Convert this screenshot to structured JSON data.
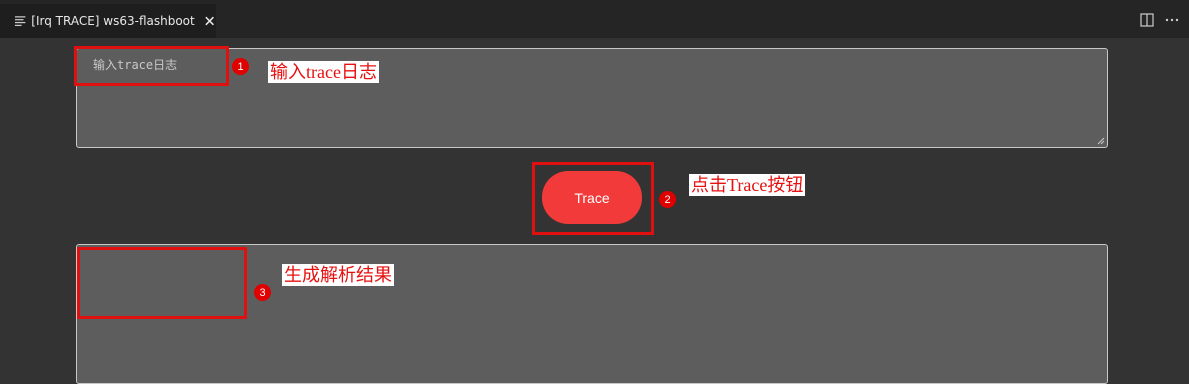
{
  "tab": {
    "title": "[Irq TRACE] ws63-flashboot"
  },
  "icons": {
    "tab": "preview-lines-icon",
    "close": "close-icon",
    "split": "split-editor-icon",
    "more": "more-actions-icon"
  },
  "input": {
    "placeholder": "输入trace日志",
    "value": ""
  },
  "button": {
    "label": "Trace"
  },
  "output": {
    "value": ""
  },
  "annotations": [
    {
      "number": "1",
      "text": "输入trace日志"
    },
    {
      "number": "2",
      "text": "点击Trace按钮"
    },
    {
      "number": "3",
      "text": "生成解析结果"
    }
  ],
  "colors": {
    "background": "#333333",
    "textarea": "#5d5d5d",
    "button": "#f23a3a",
    "annotation": "#e01010"
  }
}
